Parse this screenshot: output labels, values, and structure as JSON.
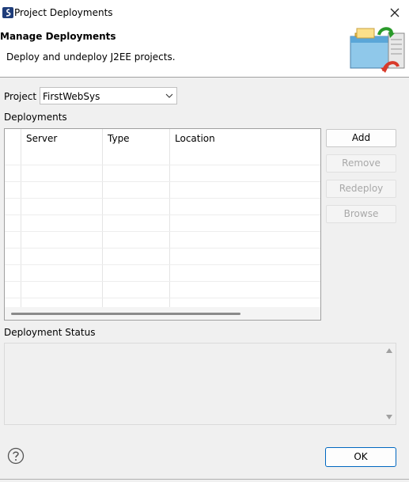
{
  "window": {
    "title": "Project Deployments"
  },
  "banner": {
    "title": "Manage Deployments",
    "description": "Deploy and undeploy J2EE projects."
  },
  "project": {
    "label": "Project",
    "selected": "FirstWebSys"
  },
  "deployments": {
    "label": "Deployments",
    "columns": [
      "",
      "Server",
      "Type",
      "Location"
    ],
    "rows": []
  },
  "buttons": {
    "add": "Add",
    "remove": "Remove",
    "redeploy": "Redeploy",
    "browse": "Browse",
    "ok": "OK"
  },
  "status": {
    "label": "Deployment Status",
    "text": ""
  },
  "icons": {
    "app": "myeclipse-app-icon",
    "close": "close-icon",
    "banner": "deploy-server-icon",
    "help": "help-icon"
  },
  "colors": {
    "ok_border": "#0067c0",
    "disabled_text": "#a8a8a8"
  }
}
